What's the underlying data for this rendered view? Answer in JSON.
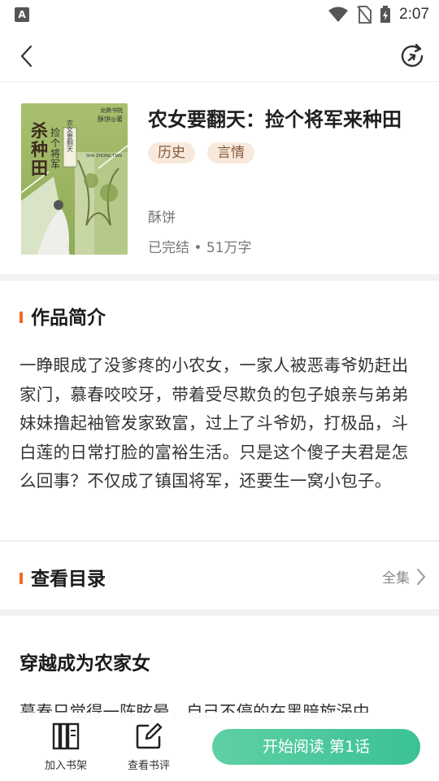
{
  "status_bar": {
    "time": "2:07",
    "app_icon_letter": "A"
  },
  "navbar": {
    "back_icon": "chevron-left-icon",
    "refresh_icon": "refresh-icon"
  },
  "book": {
    "title": "农女要翻天：捡个将军来种田",
    "tags": [
      "历史",
      "言情"
    ],
    "author": "酥饼",
    "status": "已完结 • 51万字",
    "cover": {
      "publisher": "龙腾书院",
      "author_line": "酥饼◎著",
      "big_title": "杀种田",
      "subtitle": "捡个将军",
      "vertical": "农女要翻天",
      "pinyin": "SHA ZHONG TIAN"
    }
  },
  "intro_section": {
    "heading": "作品简介",
    "text": "一睁眼成了没爹疼的小农女，一家人被恶毒爷奶赶出家门，慕春咬咬牙，带着受尽欺负的包子娘亲与弟弟妹妹撸起袖管发家致富，过上了斗爷奶，打极品，斗白莲的日常打脸的富裕生活。只是这个傻子夫君是怎么回事？不仅成了镇国将军，还要生一窝小包子。"
  },
  "toc_section": {
    "heading": "查看目录",
    "all_label": "全集"
  },
  "chapter": {
    "title": "穿越成为农家女",
    "preview": "慕春只觉得一阵眩晕，自己不停的在黑暗旋涡中"
  },
  "bottom_bar": {
    "shelf_label": "加入书架",
    "review_label": "查看书评",
    "read_button": "开始阅读 第1话"
  },
  "colors": {
    "accent": "#f06a22",
    "read_button": "#45c69b",
    "tag_bg": "#f7e9dc",
    "tag_text": "#8a5a3c"
  }
}
